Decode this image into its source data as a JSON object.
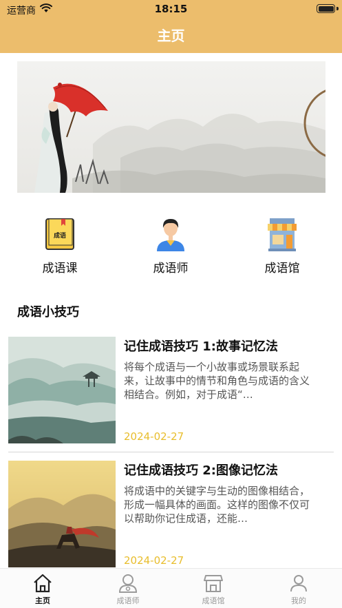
{
  "status_bar": {
    "carrier": "运营商",
    "time": "18:15"
  },
  "header": {
    "title": "主页"
  },
  "quick_entries": [
    {
      "label": "成语课",
      "icon": "book-icon",
      "book_text": "成语"
    },
    {
      "label": "成语师",
      "icon": "teacher-icon"
    },
    {
      "label": "成语馆",
      "icon": "shop-icon"
    }
  ],
  "section": {
    "title": "成语小技巧"
  },
  "articles": [
    {
      "title": "记住成语技巧 1:故事记忆法",
      "summary": "将每个成语与一个小故事或场景联系起来，让故事中的情节和角色与成语的含义相结合。例如，对于成语“…",
      "date": "2024-02-27"
    },
    {
      "title": "记住成语技巧 2:图像记忆法",
      "summary": "将成语中的关键字与生动的图像相结合，形成一幅具体的画面。这样的图像不仅可以帮助你记住成语，还能…",
      "date": "2024-02-27"
    }
  ],
  "tabbar": {
    "active": "主页",
    "items": [
      {
        "label": "主页",
        "icon": "home-icon"
      },
      {
        "label": "成语师",
        "icon": "teacher-tab-icon"
      },
      {
        "label": "成语馆",
        "icon": "store-tab-icon"
      },
      {
        "label": "我的",
        "icon": "profile-icon"
      }
    ]
  },
  "colors": {
    "header": "#ecbd6c",
    "date": "#e8bd2c",
    "umbrella": "#d9302a"
  }
}
